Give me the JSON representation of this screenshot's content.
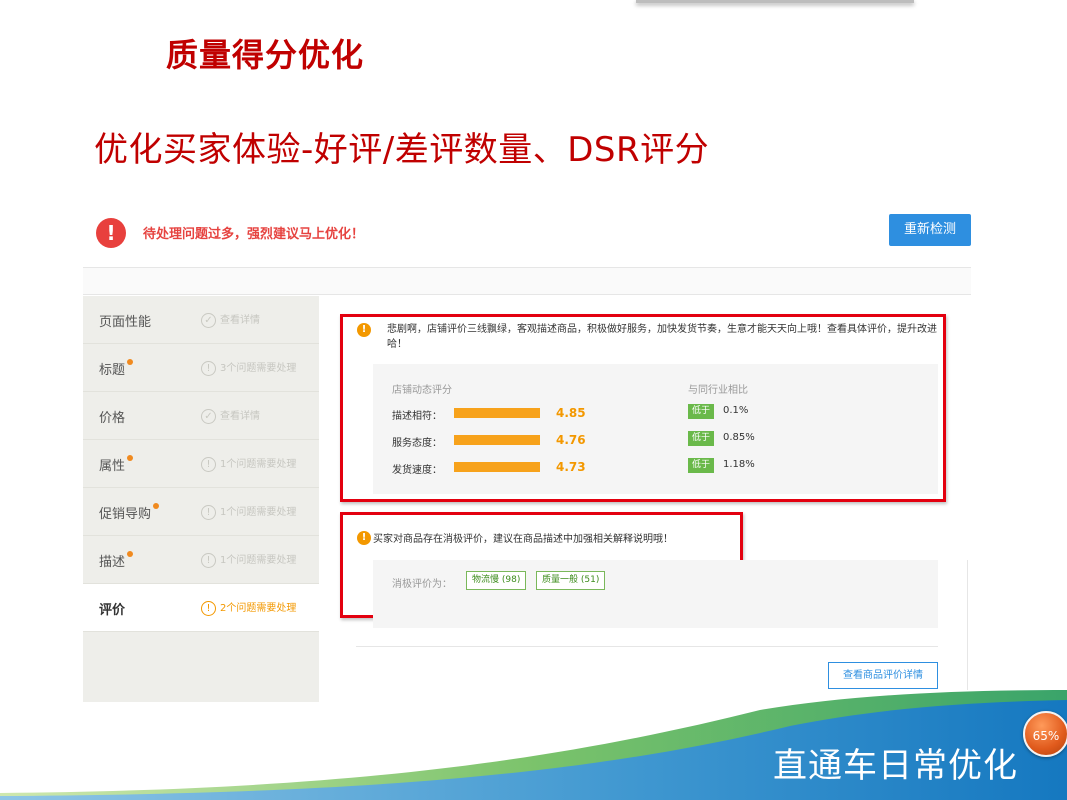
{
  "slide": {
    "heading": "质量得分优化",
    "subtitle": "优化买家体验-好评/差评数量、DSR评分",
    "footer_title": "直通车日常优化",
    "progress_badge": "65%",
    "progress_value": 65
  },
  "alert": {
    "message": "待处理问题过多，强烈建议马上优化！",
    "recheck_button": "重新检测"
  },
  "sidebar": {
    "items": [
      {
        "label": "页面性能",
        "status": "查看详情",
        "has_dot": false,
        "icon": "check-icon"
      },
      {
        "label": "标题",
        "status": "3个问题需要处理",
        "has_dot": true,
        "icon": "warning-icon"
      },
      {
        "label": "价格",
        "status": "查看详情",
        "has_dot": false,
        "icon": "check-icon"
      },
      {
        "label": "属性",
        "status": "1个问题需要处理",
        "has_dot": true,
        "icon": "warning-icon"
      },
      {
        "label": "促销导购",
        "status": "1个问题需要处理",
        "has_dot": true,
        "icon": "warning-icon"
      },
      {
        "label": "描述",
        "status": "1个问题需要处理",
        "has_dot": true,
        "icon": "warning-icon"
      },
      {
        "label": "评价",
        "status": "2个问题需要处理",
        "has_dot": false,
        "icon": "warning-icon",
        "active": true
      }
    ]
  },
  "dsr": {
    "message": "悲剧啊，店铺评价三线飘绿，客观描述商品，积极做好服务，加快发货节奏，生意才能天天向上哦！查看具体评价，提升改进哈！",
    "panel_title": "店铺动态评分",
    "compare_title": "与同行业相比",
    "rows": [
      {
        "label": "描述相符：",
        "score": "4.85",
        "compare": "低于",
        "percent": "0.1%"
      },
      {
        "label": "服务态度：",
        "score": "4.76",
        "compare": "低于",
        "percent": "0.85%"
      },
      {
        "label": "发货速度：",
        "score": "4.73",
        "compare": "低于",
        "percent": "1.18%"
      }
    ]
  },
  "negative": {
    "message": "买家对商品存在消极评价，建议在商品描述中加强相关解释说明哦！",
    "label": "消极评价为：",
    "tags": [
      "物流慢 (98)",
      "质量一般 (51)"
    ],
    "detail_button": "查看商品评价详情"
  },
  "colors": {
    "accent_red": "#c00000",
    "highlight_box": "#e3000f",
    "score_orange": "#f39800",
    "button_blue": "#2e8fe0",
    "tag_green": "#6ab94a"
  }
}
